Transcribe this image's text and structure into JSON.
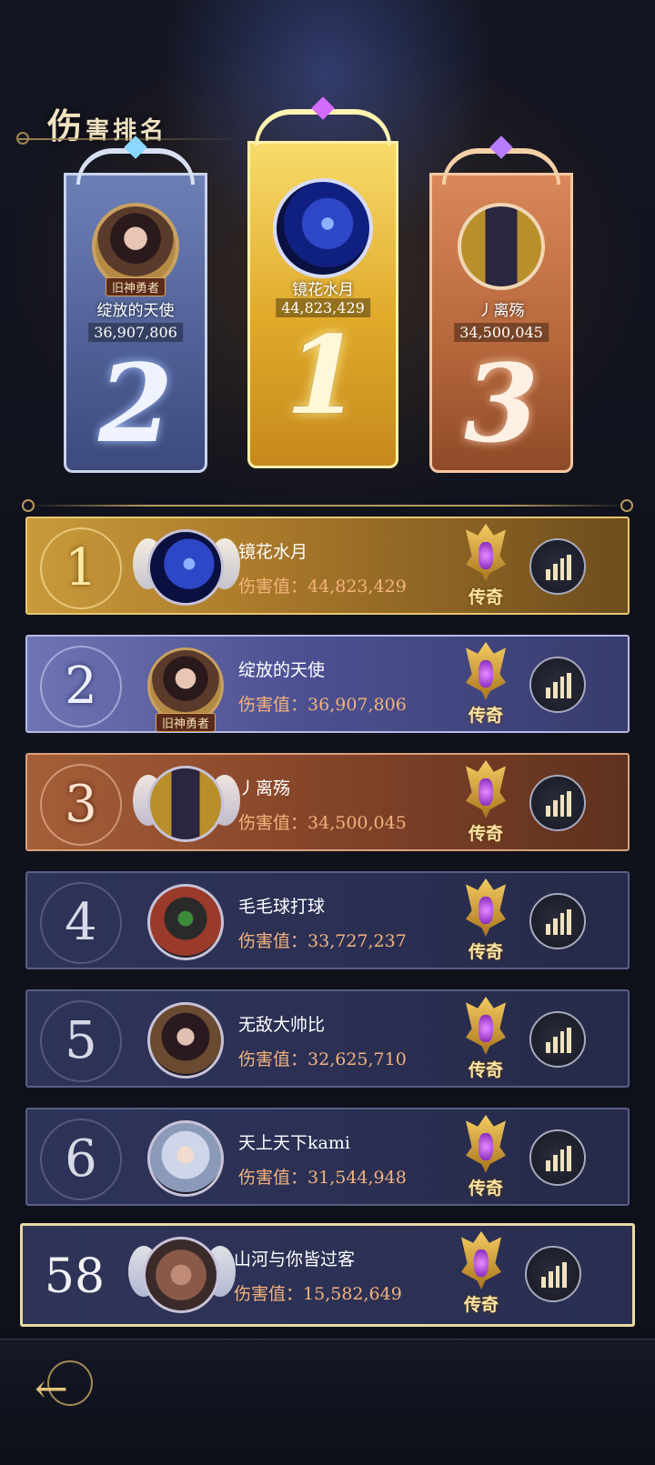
{
  "title": {
    "first": "伤",
    "rest": "害排名"
  },
  "podium": [
    {
      "place": "2",
      "name": "绽放的天使",
      "score": "36,907,806",
      "badge": "旧神勇者"
    },
    {
      "place": "1",
      "name": "镜花水月",
      "score": "44,823,429",
      "badge": ""
    },
    {
      "place": "3",
      "name": "丿离殇",
      "score": "34,500,045",
      "badge": ""
    }
  ],
  "score_label": "伤害值：",
  "rows": [
    {
      "rank": "1",
      "name": "镜花水月",
      "score": "44,823,429",
      "tier": "传奇",
      "badge": ""
    },
    {
      "rank": "2",
      "name": "绽放的天使",
      "score": "36,907,806",
      "tier": "传奇",
      "badge": "旧神勇者"
    },
    {
      "rank": "3",
      "name": "丿离殇",
      "score": "34,500,045",
      "tier": "传奇",
      "badge": ""
    },
    {
      "rank": "4",
      "name": "毛毛球打球",
      "score": "33,727,237",
      "tier": "传奇",
      "badge": ""
    },
    {
      "rank": "5",
      "name": "无敌大帅比",
      "score": "32,625,710",
      "tier": "传奇",
      "badge": ""
    },
    {
      "rank": "6",
      "name": "天上天下kami",
      "score": "31,544,948",
      "tier": "传奇",
      "badge": ""
    }
  ],
  "me": {
    "rank": "58",
    "name": "山河与你皆过客",
    "score": "15,582,649",
    "tier": "传奇"
  },
  "colors": {
    "gold": "#e0a92a",
    "silver": "#4e5f95",
    "bronze": "#b4653a",
    "score_text": "#f4b27c"
  },
  "icons": {
    "stats": "bar-chart-icon",
    "back": "back-arrow-icon",
    "tier": "legend-emblem-icon"
  }
}
